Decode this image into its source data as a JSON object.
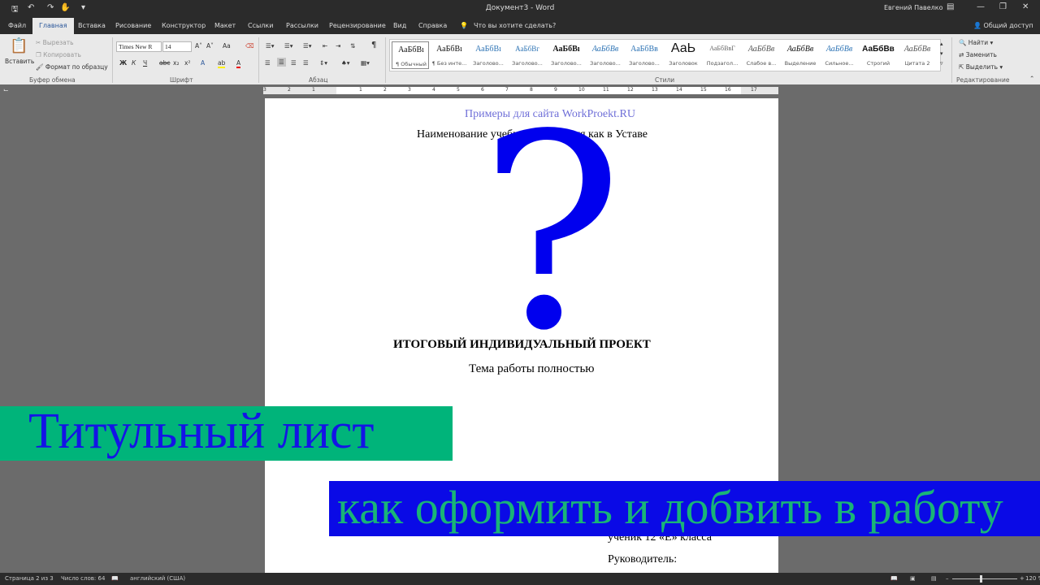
{
  "window": {
    "title": "Документ3  -  Word",
    "user": "Евгений Павелко",
    "share": "Общий доступ"
  },
  "tabs": [
    {
      "label": "Файл"
    },
    {
      "label": "Главная"
    },
    {
      "label": "Вставка"
    },
    {
      "label": "Рисование"
    },
    {
      "label": "Конструктор"
    },
    {
      "label": "Макет"
    },
    {
      "label": "Ссылки"
    },
    {
      "label": "Рассылки"
    },
    {
      "label": "Рецензирование"
    },
    {
      "label": "Вид"
    },
    {
      "label": "Справка"
    }
  ],
  "tellme": "Что вы хотите сделать?",
  "ribbon": {
    "clipboard": {
      "paste": "Вставить",
      "cut": "Вырезать",
      "copy": "Копировать",
      "format_painter": "Формат по образцу",
      "group": "Буфер обмена"
    },
    "font": {
      "name": "Times New R",
      "size": "14",
      "bold": "Ж",
      "italic": "К",
      "underline": "Ч",
      "strike": "abc",
      "sub": "x₂",
      "sup": "x²",
      "case": "Aa",
      "grow": "A˄",
      "shrink": "A˅",
      "color_letter": "A",
      "highlight": "ab",
      "group": "Шрифт"
    },
    "paragraph": {
      "pilcrow": "¶",
      "group": "Абзац"
    },
    "styles": {
      "group": "Стили",
      "items": [
        {
          "preview": "АаБбВı",
          "name": "¶ Обычный"
        },
        {
          "preview": "АаБбВı",
          "name": "¶ Без инте..."
        },
        {
          "preview": "АаБбВı",
          "name": "Заголово..."
        },
        {
          "preview": "АаБбВг",
          "name": "Заголово..."
        },
        {
          "preview": "АаБбВı",
          "name": "Заголово..."
        },
        {
          "preview": "АаБбВв",
          "name": "Заголово..."
        },
        {
          "preview": "АаБбВв",
          "name": "Заголово..."
        },
        {
          "preview": "АаЬ",
          "name": "Заголовок"
        },
        {
          "preview": "АаБбВвГ",
          "name": "Подзагол..."
        },
        {
          "preview": "АаБбВв",
          "name": "Слабое в..."
        },
        {
          "preview": "АаБбВв",
          "name": "Выделение"
        },
        {
          "preview": "АаБбВв",
          "name": "Сильное..."
        },
        {
          "preview": "АаБбВв",
          "name": "Строгий"
        },
        {
          "preview": "АаБбВв",
          "name": "Цитата 2"
        }
      ]
    },
    "editing": {
      "find": "Найти",
      "replace": "Заменить",
      "select": "Выделить",
      "group": "Редактирование"
    }
  },
  "ruler": [
    "3",
    "2",
    "1",
    "1",
    "2",
    "3",
    "4",
    "5",
    "6",
    "7",
    "8",
    "9",
    "10",
    "11",
    "12",
    "13",
    "14",
    "15",
    "16",
    "17"
  ],
  "document": {
    "site": "Примеры для сайта WorkProekt.RU",
    "institution": "Наименование учебного заведения как в Уставе",
    "question_mark": "?",
    "project": "ИТОГОВЫЙ ИНДИВИДУАЛЬНЫЙ ПРОЕКТ",
    "topic": "Тема работы полностью",
    "student": "ученик 12 «Е» класса",
    "supervisor": "Руководитель:"
  },
  "overlay": {
    "line1": "Титульный лист",
    "line2": "как оформить и добвить в работу"
  },
  "status": {
    "page": "Страница 2 из 3",
    "words": "Число слов: 64",
    "language": "английский (США)",
    "zoom": "120 %"
  },
  "colors": {
    "word_blue": "#2b579a",
    "banner_green": "#00b47a",
    "banner_blue": "#0a0ae6",
    "question_blue": "#0000ee",
    "site_link": "#6f6fd8"
  }
}
